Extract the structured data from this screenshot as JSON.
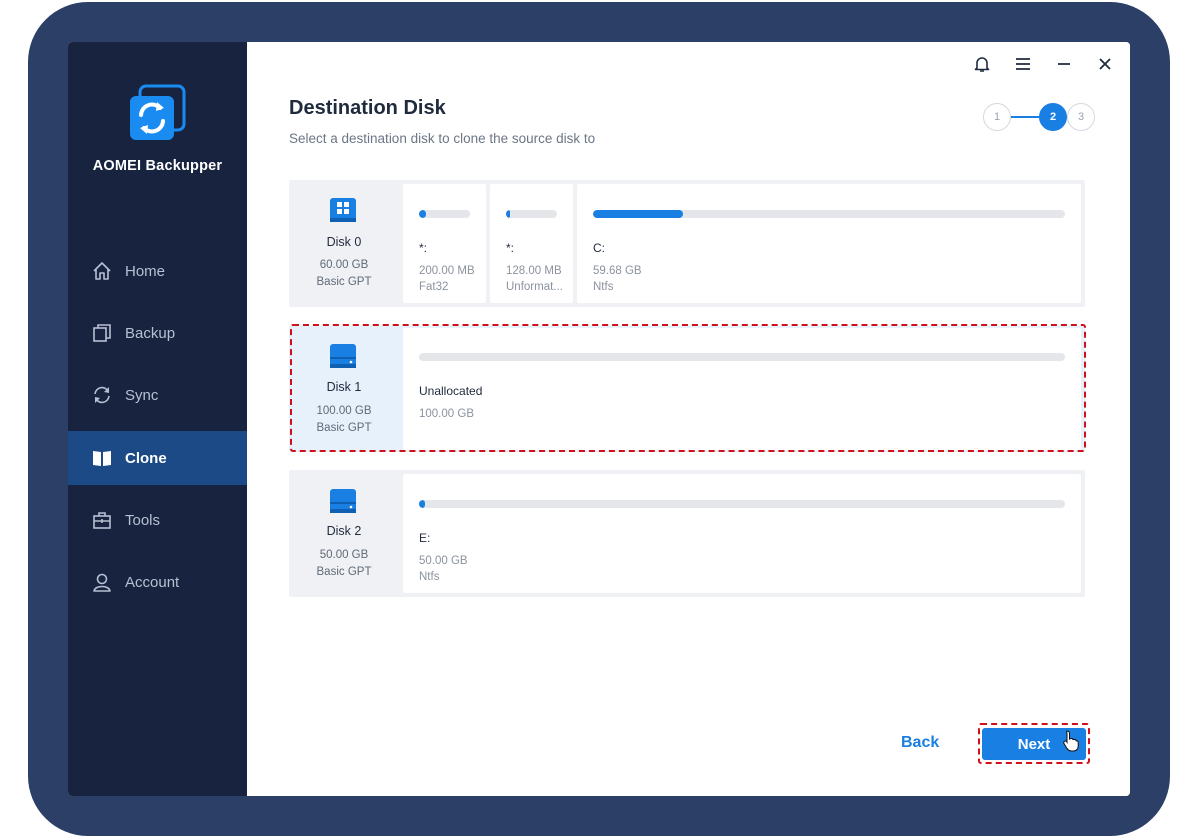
{
  "app": {
    "name": "AOMEI Backupper"
  },
  "colors": {
    "frame": "#2b3f67",
    "sidebar": "#17233f",
    "active_nav": "#1b4a86",
    "accent": "#1a7fe3",
    "highlight": "#d0101a"
  },
  "sidebar": {
    "items": [
      {
        "label": "Home",
        "icon": "home-icon",
        "active": false
      },
      {
        "label": "Backup",
        "icon": "backup-icon",
        "active": false
      },
      {
        "label": "Sync",
        "icon": "sync-icon",
        "active": false
      },
      {
        "label": "Clone",
        "icon": "clone-icon",
        "active": true
      },
      {
        "label": "Tools",
        "icon": "tools-icon",
        "active": false
      },
      {
        "label": "Account",
        "icon": "account-icon",
        "active": false
      }
    ]
  },
  "header": {
    "title": "Destination Disk",
    "subtitle": "Select a destination disk to clone the source disk to",
    "window_controls": [
      "bell-icon",
      "menu-icon",
      "minimize-icon",
      "close-icon"
    ]
  },
  "stepper": {
    "steps": [
      "1",
      "2",
      "3"
    ],
    "current": 2
  },
  "disks": [
    {
      "name": "Disk 0",
      "size": "60.00 GB",
      "type": "Basic GPT",
      "icon": "windows-disk-icon",
      "partitions": [
        {
          "label": "*:",
          "size": "200.00 MB",
          "fs": "Fat32",
          "used_percent": 14
        },
        {
          "label": "*:",
          "size": "128.00 MB",
          "fs": "Unformat...",
          "used_percent": 8
        },
        {
          "label": "C:",
          "size": "59.68 GB",
          "fs": "Ntfs",
          "used_percent": 19
        }
      ]
    },
    {
      "name": "Disk 1",
      "size": "100.00 GB",
      "type": "Basic GPT",
      "icon": "disk-icon",
      "selected": true,
      "partitions": [
        {
          "label": "Unallocated",
          "size": "100.00 GB",
          "fs": "",
          "used_percent": 0
        }
      ]
    },
    {
      "name": "Disk 2",
      "size": "50.00 GB",
      "type": "Basic GPT",
      "icon": "disk-icon",
      "partitions": [
        {
          "label": "E:",
          "size": "50.00 GB",
          "fs": "Ntfs",
          "used_percent": 1
        }
      ]
    }
  ],
  "footer": {
    "back_label": "Back",
    "next_label": "Next"
  }
}
